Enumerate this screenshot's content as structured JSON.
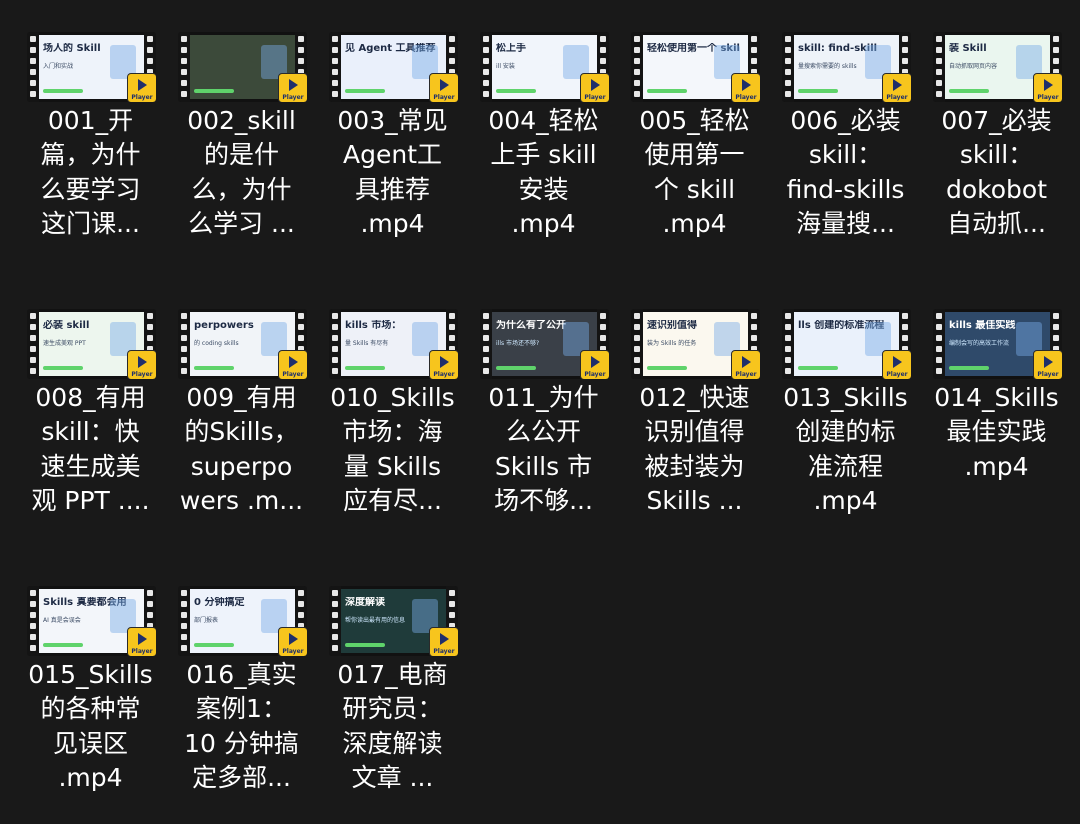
{
  "badge_label": "Player",
  "files": [
    {
      "name_lines": [
        "001_开",
        "篇，为什",
        "么要学习",
        "这门课..."
      ],
      "thumb_title": "场人的 Skill",
      "thumb_sub": "入门和实战",
      "thumb_bg": "#eef3fa",
      "thumb_dark": false
    },
    {
      "name_lines": [
        "002_skill",
        "的是什",
        "么，为什",
        "么学习 ..."
      ],
      "thumb_title": "",
      "thumb_sub": "",
      "thumb_bg": "#3c4a3a",
      "thumb_dark": true
    },
    {
      "name_lines": [
        "003_常见",
        "Agent工",
        "具推荐",
        ".mp4"
      ],
      "thumb_title": "见 Agent 工具推荐",
      "thumb_sub": "",
      "thumb_bg": "#eaf0fb",
      "thumb_dark": false
    },
    {
      "name_lines": [
        "004_轻松",
        "上手 skill",
        "安装",
        ".mp4"
      ],
      "thumb_title": "松上手",
      "thumb_sub": "ill 安装",
      "thumb_bg": "#f1f5fb",
      "thumb_dark": false
    },
    {
      "name_lines": [
        "005_轻松",
        "使用第一",
        "个 skill",
        ".mp4"
      ],
      "thumb_title": "轻松使用第一个 skil",
      "thumb_sub": "",
      "thumb_bg": "#f4f7fb",
      "thumb_dark": false
    },
    {
      "name_lines": [
        "006_必装",
        "skill：",
        "find-skills",
        "海量搜..."
      ],
      "thumb_title": "skill: find-skill",
      "thumb_sub": "量搜索你需要的 skills",
      "thumb_bg": "#eef3f9",
      "thumb_dark": false
    },
    {
      "name_lines": [
        "007_必装",
        "skill：",
        "dokobot",
        "自动抓..."
      ],
      "thumb_title": "装 Skill",
      "thumb_sub": "自动抓取网页内容",
      "thumb_bg": "#eaf6ef",
      "thumb_dark": false
    },
    {
      "name_lines": [
        "008_有用",
        "skill：快",
        "速生成美",
        "观 PPT ...."
      ],
      "thumb_title": "必装 skill",
      "thumb_sub": "速生成美观 PPT",
      "thumb_bg": "#edf6ee",
      "thumb_dark": false
    },
    {
      "name_lines": [
        "009_有用",
        "的Skills，",
        "superpo",
        "wers .m..."
      ],
      "thumb_title": "perpowers",
      "thumb_sub": "的 coding skills",
      "thumb_bg": "#f1f4f8",
      "thumb_dark": false
    },
    {
      "name_lines": [
        "010_Skills",
        "市场：海",
        "量 Skills",
        "应有尽..."
      ],
      "thumb_title": "kills 市场：",
      "thumb_sub": "量 Skills 有尽有",
      "thumb_bg": "#eef1f8",
      "thumb_dark": false
    },
    {
      "name_lines": [
        "011_为什",
        "么公开",
        "Skills 市",
        "场不够..."
      ],
      "thumb_title": "为什么有了公开",
      "thumb_sub": "ills 市场还不够?",
      "thumb_bg": "#3a4048",
      "thumb_dark": true
    },
    {
      "name_lines": [
        "012_快速",
        "识别值得",
        "被封装为",
        "Skills ..."
      ],
      "thumb_title": "速识别值得",
      "thumb_sub": "装为 Skills 的任务",
      "thumb_bg": "#fbf8ef",
      "thumb_dark": false
    },
    {
      "name_lines": [
        "013_Skills",
        "创建的标",
        "准流程",
        ".mp4"
      ],
      "thumb_title": "lls 创建的标准流程",
      "thumb_sub": "",
      "thumb_bg": "#eaf1fb",
      "thumb_dark": false
    },
    {
      "name_lines": [
        "014_Skills",
        "最佳实践",
        ".mp4"
      ],
      "thumb_title": "kills 最佳实践",
      "thumb_sub": "编制会写的高效工作流",
      "thumb_bg": "#2f4a6a",
      "thumb_dark": true
    },
    {
      "name_lines": [
        "015_Skills",
        "的各种常",
        "见误区",
        ".mp4"
      ],
      "thumb_title": "Skills 真要都会用",
      "thumb_sub": "AI 真是会误会",
      "thumb_bg": "#f3f6fa",
      "thumb_dark": false
    },
    {
      "name_lines": [
        "016_真实",
        "案例1：",
        "10 分钟搞",
        "定多部..."
      ],
      "thumb_title": "0 分钟搞定",
      "thumb_sub": "部门报表",
      "thumb_bg": "#eef3fb",
      "thumb_dark": false
    },
    {
      "name_lines": [
        "017_电商",
        "研究员：",
        "深度解读",
        "文章 ..."
      ],
      "thumb_title": "深度解读",
      "thumb_sub": "帮你读出最有用的信息",
      "thumb_bg": "#1f3b3a",
      "thumb_dark": true
    }
  ]
}
